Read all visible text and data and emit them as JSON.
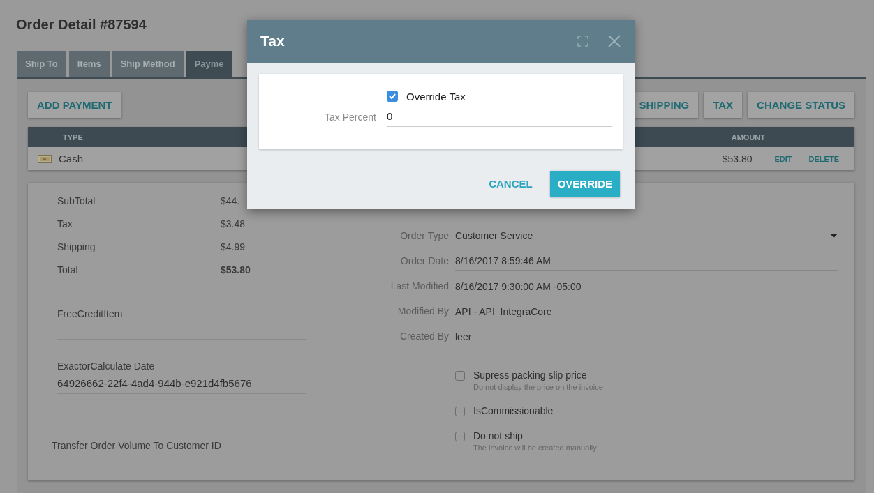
{
  "page": {
    "title": "Order Detail #87594"
  },
  "tabs": [
    {
      "label": "Ship To",
      "selected": false
    },
    {
      "label": "Items",
      "selected": false
    },
    {
      "label": "Ship Method",
      "selected": false
    },
    {
      "label": "Payme",
      "selected": true
    }
  ],
  "payment_actions": [
    "ADD PAYMENT"
  ],
  "order_actions": [
    "SHIPPING",
    "TAX",
    "CHANGE STATUS"
  ],
  "payments_table": {
    "columns": [
      "TYPE",
      "AMOUNT"
    ],
    "rows": [
      {
        "type": "Cash",
        "amount": "$53.80",
        "actions": [
          "EDIT",
          "DELETE"
        ]
      }
    ]
  },
  "totals": [
    {
      "label": "SubTotal",
      "value": "$44.",
      "emphasis": false
    },
    {
      "label": "Tax",
      "value": "$3.48",
      "emphasis": false
    },
    {
      "label": "Shipping",
      "value": "$4.99",
      "emphasis": false
    },
    {
      "label": "Total",
      "value": "$53.80",
      "emphasis": true
    }
  ],
  "custom_fields": [
    {
      "label": "FreeCreditItem"
    },
    {
      "label": "ExactorCalculate Date",
      "value": "64926662-22f4-4ad4-944b-e921d4fb5676"
    },
    {
      "label": "Transfer Order Volume To Customer ID"
    }
  ],
  "order_info": [
    {
      "label": "Order Type",
      "value": "Customer Service",
      "kind": "select"
    },
    {
      "label": "Order Date",
      "value": "8/16/2017 8:59:46 AM",
      "kind": "input"
    },
    {
      "label": "Last Modified",
      "value": "8/16/2017 9:30:00 AM -05:00",
      "kind": "text"
    },
    {
      "label": "Modified By",
      "value": "API - API_IntegraCore",
      "kind": "text"
    },
    {
      "label": "Created By",
      "value": "leer",
      "kind": "text"
    }
  ],
  "options": [
    {
      "label": "Supress packing slip price",
      "hint": "Do not display the price on the invoice",
      "checked": false
    },
    {
      "label": "IsCommissionable",
      "checked": false
    },
    {
      "label": "Do not ship",
      "hint": "The invoice will be created manually",
      "checked": false
    }
  ],
  "dialog": {
    "title": "Tax",
    "override": {
      "label": "Override Tax",
      "checked": true
    },
    "tax_percent": {
      "label": "Tax Percent",
      "value": "0"
    },
    "buttons": [
      {
        "label": "CANCEL",
        "kind": "text"
      },
      {
        "label": "OVERRIDE",
        "kind": "primary"
      }
    ]
  }
}
